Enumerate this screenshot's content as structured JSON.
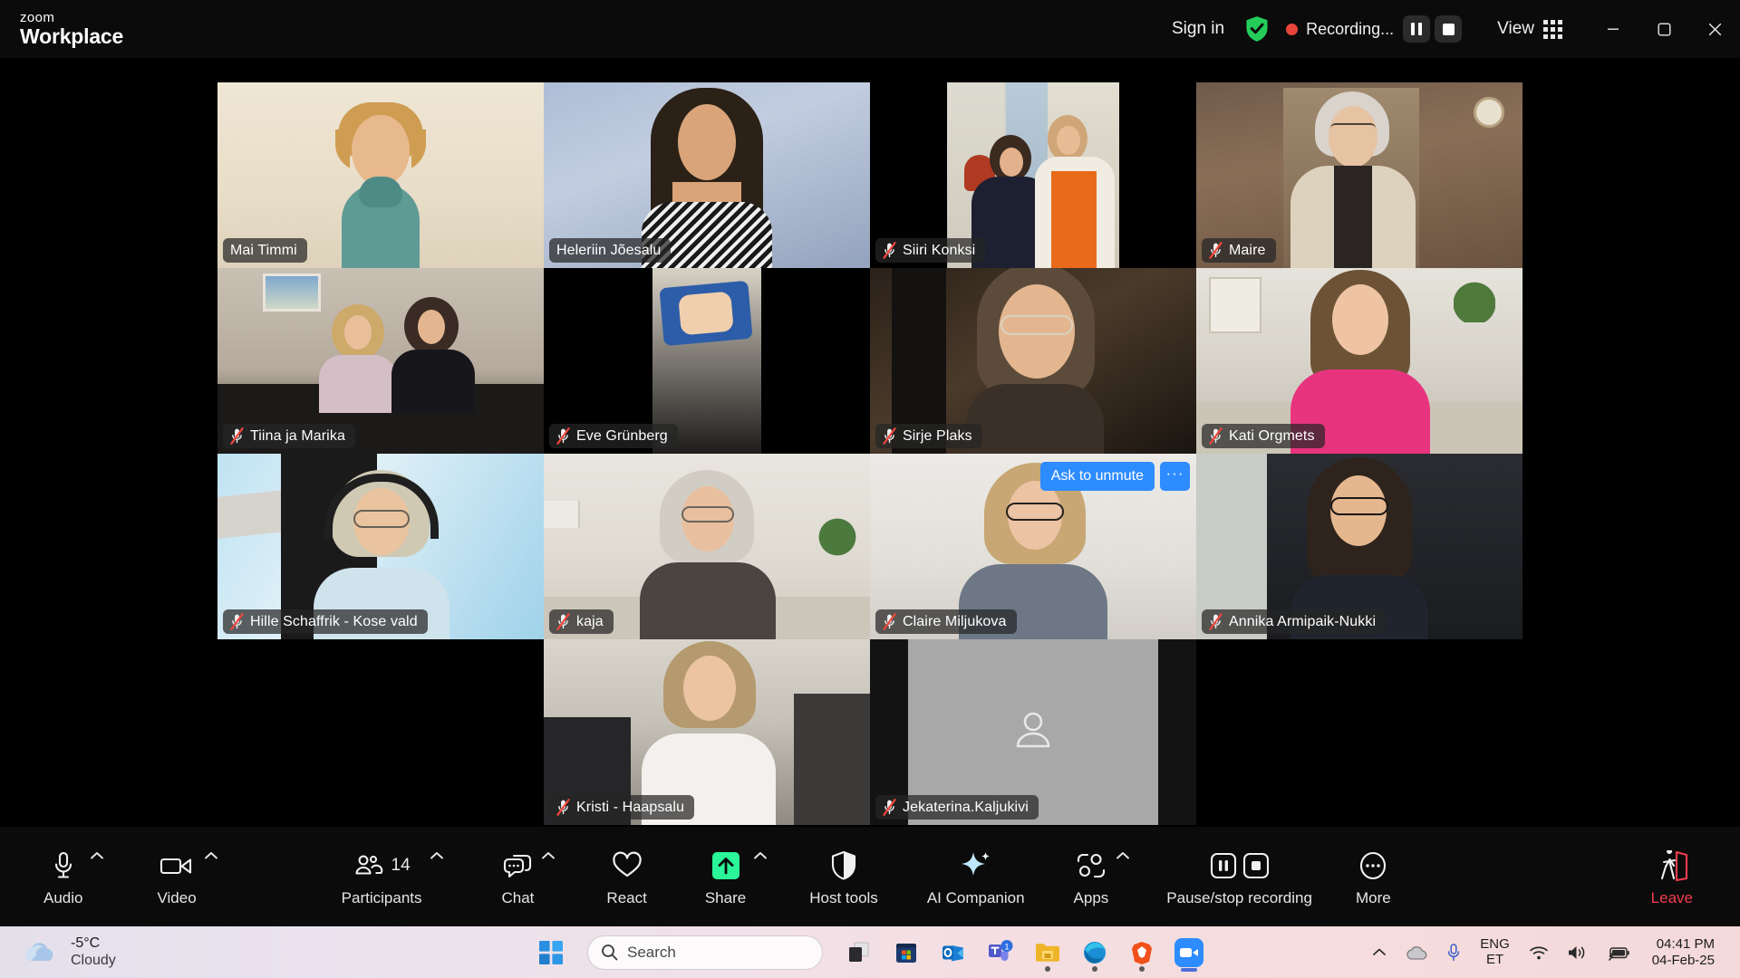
{
  "titlebar": {
    "brand_line1": "zoom",
    "brand_line2": "Workplace",
    "sign_in": "Sign in",
    "shield_icon": "shield-check-icon",
    "recording_label": "Recording...",
    "pause_recording_icon": "pause-icon",
    "stop_recording_icon": "stop-icon",
    "view_label": "View",
    "view_icon": "grid-view-icon",
    "minimize_icon": "minimize-icon",
    "maximize_icon": "restore-icon",
    "close_icon": "close-icon"
  },
  "meeting": {
    "active_speaker": "Heleriin Jõesalu",
    "hover_tile": {
      "ask_to_unmute": "Ask to unmute",
      "more_label": "···"
    },
    "participants": [
      {
        "name": "Mai Timmi",
        "muted": false,
        "active": false,
        "row": 1
      },
      {
        "name": "Heleriin Jõesalu",
        "muted": false,
        "active": true,
        "row": 1
      },
      {
        "name": "Siiri Konksi",
        "muted": true,
        "active": false,
        "row": 1
      },
      {
        "name": "Maire",
        "muted": true,
        "active": false,
        "row": 1
      },
      {
        "name": "Tiina ja Marika",
        "muted": true,
        "active": false,
        "row": 2
      },
      {
        "name": "Eve Grünberg",
        "muted": true,
        "active": false,
        "row": 2
      },
      {
        "name": "Sirje Plaks",
        "muted": true,
        "active": false,
        "row": 2
      },
      {
        "name": "Kati Orgmets",
        "muted": true,
        "active": false,
        "row": 2
      },
      {
        "name": "Hille Schaffrik - Kose vald",
        "muted": true,
        "active": false,
        "row": 3
      },
      {
        "name": "kaja",
        "muted": true,
        "active": false,
        "row": 3
      },
      {
        "name": "Claire Miljukova",
        "muted": true,
        "active": false,
        "row": 3
      },
      {
        "name": "Annika Armipaik-Nukki",
        "muted": true,
        "active": false,
        "row": 3
      },
      {
        "name": "Kristi - Haapsalu",
        "muted": true,
        "active": false,
        "row": 4
      },
      {
        "name": "Jekaterina.Kaljukivi",
        "muted": true,
        "active": false,
        "row": 4
      }
    ]
  },
  "controls": {
    "audio": {
      "label": "Audio",
      "icon": "microphone-icon",
      "has_caret": true
    },
    "video": {
      "label": "Video",
      "icon": "camera-icon",
      "has_caret": true
    },
    "participants": {
      "label": "Participants",
      "icon": "participants-icon",
      "count": "14",
      "has_caret": true
    },
    "chat": {
      "label": "Chat",
      "icon": "chat-bubble-icon",
      "has_caret": true
    },
    "react": {
      "label": "React",
      "icon": "heart-icon",
      "has_caret": false
    },
    "share": {
      "label": "Share",
      "icon": "share-screen-icon",
      "has_caret": true
    },
    "host_tools": {
      "label": "Host tools",
      "icon": "shield-icon",
      "has_caret": false
    },
    "ai_companion": {
      "label": "AI Companion",
      "icon": "sparkle-icon",
      "has_caret": false
    },
    "apps": {
      "label": "Apps",
      "icon": "apps-icon",
      "has_caret": true
    },
    "recording": {
      "label": "Pause/stop recording",
      "icon": "pause-stop-icon",
      "has_caret": false
    },
    "more": {
      "label": "More",
      "icon": "ellipsis-icon",
      "has_caret": false
    },
    "leave": {
      "label": "Leave",
      "icon": "leave-door-icon",
      "has_caret": false
    }
  },
  "taskbar": {
    "weather": {
      "temperature": "-5°C",
      "condition": "Cloudy",
      "icon": "cloud-icon"
    },
    "start_icon": "windows-start-icon",
    "search": {
      "placeholder": "Search",
      "icon": "search-icon"
    },
    "apps": [
      {
        "name": "task-view-icon",
        "running": false
      },
      {
        "name": "microsoft-store-icon",
        "running": false
      },
      {
        "name": "outlook-icon",
        "running": false
      },
      {
        "name": "microsoft-teams-icon",
        "running": false,
        "badge": "1"
      },
      {
        "name": "file-explorer-icon",
        "running": true
      },
      {
        "name": "microsoft-edge-icon",
        "running": true
      },
      {
        "name": "brave-browser-icon",
        "running": true
      },
      {
        "name": "zoom-icon",
        "running": false,
        "current": true
      }
    ],
    "tray": {
      "overflow_icon": "chevron-up-icon",
      "cloud_icon": "onedrive-icon",
      "mic_icon": "microphone-icon",
      "language_line1": "ENG",
      "language_line2": "ET",
      "wifi_icon": "wifi-icon",
      "volume_icon": "speaker-icon",
      "battery_icon": "battery-charging-icon",
      "time": "04:41 PM",
      "date": "04-Feb-25"
    }
  },
  "colors": {
    "accent_blue": "#2d8cff",
    "active_green": "#37e08a",
    "record_red": "#e8443a",
    "leave_red": "#ef3d4e",
    "titlebar_bg": "#0b0b0b"
  }
}
